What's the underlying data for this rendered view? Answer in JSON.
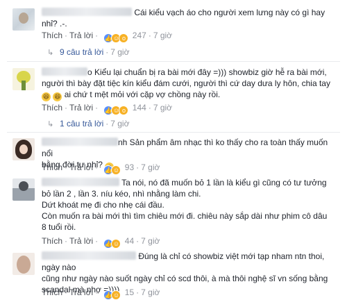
{
  "comments": [
    {
      "text": "Cái kiểu vạch áo cho người xem lưng này có gì hay nhỉ? .-.",
      "actions": {
        "like": "Thích",
        "reply": "Trả lời",
        "reactions": "247",
        "time": "7 giờ"
      },
      "replies": {
        "label": "9 câu trả lời",
        "time": "7 giờ"
      }
    },
    {
      "text_line1": "o Kiểu lại chuẩn bị ra bài mới đây =))) showbiz giờ hễ ra bài mới,",
      "text_line2": "người thì bày đặt tiệc kín kiểu đám cưới, người thì cứ day dưa ly hôn, chia tay",
      "text_line3": "ai chứ t mệt mỏi với cặp vợ chồng này rồi.",
      "actions": {
        "like": "Thích",
        "reply": "Trả lời",
        "reactions": "144",
        "time": "7 giờ"
      },
      "replies": {
        "label": "1 câu trả lời",
        "time": "7 giờ"
      }
    },
    {
      "text_line1": "nh Sản phẩm âm nhạc thì ko thấy cho ra toàn thấy muốn nổi",
      "text_line2": "bằng đời tư nhỉ?",
      "actions": {
        "like": "Thích",
        "reply": "Trả lời",
        "reactions": "93",
        "time": "7 giờ"
      }
    },
    {
      "text_line1": "Ta nói, nó đã muốn bỏ 1 lần là kiểu gì cũng có tư tưởng",
      "text_line2": "bỏ lần 2 , lần 3. níu kéo, nhì nhằng làm chi.",
      "text_line3": "Dứt khoát mẹ đi cho nhẹ cái đầu.",
      "text_line4": "Còn muốn ra bài mới thì tìm chiêu mới đi. chiêu này sắp dài như phim cô dâu",
      "text_line5": "8 tuổi rồi.",
      "actions": {
        "like": "Thích",
        "reply": "Trả lời",
        "reactions": "44",
        "time": "7 giờ"
      }
    },
    {
      "text_line1": "Đúng là chỉ có showbiz việt mới tạp nham ntn thoi, ngày nào",
      "text_line2": "cũng như ngày nào suốt ngày chỉ có scd thôi, à mà thôi nghệ sĩ vn sống bằng",
      "text_line3": "scandal mà nhợ =))))",
      "actions": {
        "like": "Thích",
        "reply": "Trả lời",
        "reactions": "15",
        "time": "7 giờ"
      }
    }
  ],
  "colors": {
    "link": "#365899",
    "meta": "#90949c",
    "like": "#5890ff",
    "reaction": "#f7b125"
  },
  "icons": [
    "like-reaction-icon",
    "wow-reaction-icon",
    "haha-reaction-icon",
    "reply-arrow-icon",
    "smile-emoji-icon"
  ]
}
